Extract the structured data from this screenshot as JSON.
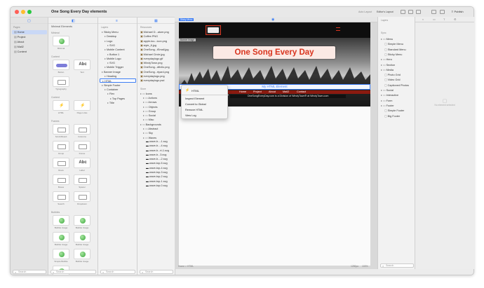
{
  "window": {
    "title": "One Song Every Day elements",
    "traffic_colors": [
      "#ff5f57",
      "#febc2e",
      "#28c840"
    ],
    "toolbar_info": "Auto Layout",
    "toolbar_layout": "Editor's Layout",
    "publish_label": "Publish"
  },
  "pages_panel": {
    "header": "Pages",
    "items": [
      {
        "label": "Home",
        "selected": true
      },
      {
        "label": "Project"
      },
      {
        "label": "About"
      },
      {
        "label": "Mail2"
      },
      {
        "label": "Content"
      }
    ],
    "search_placeholder": "Search"
  },
  "library_panel": {
    "header": "Minimal Elements",
    "sections": [
      {
        "title": "Minimal",
        "items": [
          "Minimal"
        ]
      },
      {
        "title": "Content",
        "items": [
          "Button",
          "Text",
          "Typography"
        ]
      },
      {
        "title": "Content",
        "items": [
          "HTML",
          "Page Links"
        ]
      },
      {
        "title": "Frames",
        "items": [
          "Scroll-Board",
          "Columns",
          "Group",
          "Frame",
          "Rows",
          "Label",
          "Boxes",
          "Spacer",
          "Search",
          "Dropdown"
        ]
      },
      {
        "title": "Bubbles",
        "items": [
          "Bubble Image",
          "Bubble Image",
          "Bubble Image",
          "Bubble Image",
          "Simple Bubble",
          "Bubble Image",
          "Library Menu"
        ]
      },
      {
        "title": "Interactive",
        "items": []
      }
    ],
    "search_placeholder": "Search"
  },
  "layers_panel": {
    "header": "Layers",
    "items": [
      {
        "label": "Sticky Menu",
        "indent": 0
      },
      {
        "label": "Desktop",
        "indent": 1
      },
      {
        "label": "Logo",
        "indent": 1
      },
      {
        "label": "SVG",
        "indent": 2
      },
      {
        "label": "Mobile Content",
        "indent": 1
      },
      {
        "label": "Button 1",
        "indent": 2
      },
      {
        "label": "Mobile Logo",
        "indent": 1
      },
      {
        "label": "SVG",
        "indent": 2
      },
      {
        "label": "Mobile Trigger",
        "indent": 1
      },
      {
        "label": "Banner Image",
        "indent": 0
      },
      {
        "label": "Heading",
        "indent": 1
      },
      {
        "label": "HTML",
        "indent": 0,
        "selected": true
      },
      {
        "label": "Simple Footer",
        "indent": 0
      },
      {
        "label": "Container",
        "indent": 1
      },
      {
        "label": "Flex",
        "indent": 2
      },
      {
        "label": "Top Pages",
        "indent": 3
      },
      {
        "label": "Title",
        "indent": 2
      }
    ],
    "search_placeholder": "Search"
  },
  "resources_panel": {
    "header": "Resources",
    "files": [
      "Michael D...ature.png",
      "Coffee.PNG",
      "apple-tou...icon.png",
      "style_8.jpg",
      "OneSong...tSmall.jpg",
      "Michael Circle.jpg",
      "everydaylogo.gif",
      "WindyTown.png",
      "OneSong...dth4lo.png",
      "OneSong...rtyard.png",
      "everydaylogo.png",
      "everydaylogo.psd"
    ],
    "folders_header": "Store",
    "folders": [
      {
        "label": "Icons",
        "indent": 0
      },
      {
        "label": "Actions",
        "indent": 1
      },
      {
        "label": "Arrows",
        "indent": 1
      },
      {
        "label": "Objects",
        "indent": 1
      },
      {
        "label": "Group",
        "indent": 1
      },
      {
        "label": "Social",
        "indent": 1
      },
      {
        "label": "Misc",
        "indent": 1
      },
      {
        "label": "Backgrounds",
        "indent": 0
      },
      {
        "label": "Abstract",
        "indent": 1
      },
      {
        "label": "Sky",
        "indent": 1
      },
      {
        "label": "Waves",
        "indent": 1
      }
    ],
    "waves": [
      "wave-b...-1.svg",
      "wave-b...-4.svg",
      "wave-b...rt-1.svg",
      "wave-b...3.svg",
      "wave-b...-2.svg",
      "wave-top-5.svg",
      "wave-top-4.svg",
      "wave-top-3.svg",
      "wave-top-2.svg",
      "wave-top-1.svg",
      "wave-top-0.svg"
    ],
    "search_placeholder": "Search"
  },
  "canvas": {
    "breadcrumb": "Home > HTML",
    "zoom": "100%",
    "size": "1280px",
    "page_tag": "Sticky Menu",
    "banner_tag": "Banner Image",
    "hero_title": "One Song Every Day",
    "html_element_label": "My HTML Element",
    "nav_items": [
      "Home",
      "Project",
      "About",
      "Mail2",
      "Contact"
    ],
    "footer_text": "OneSongEveryDay.com is a Division of WindyTown® at WindyTown.com",
    "hero_colors": {
      "banner_bg": "#fbe9e4",
      "title": "#d9341e",
      "nav": "#8a1a10"
    }
  },
  "context_menu": {
    "header": "HTML",
    "items": [
      "Inspect Element",
      "Convert to Global",
      "Remove HTML",
      "View Log"
    ]
  },
  "inspector": {
    "header": "Layers",
    "subheader": "Sync",
    "tree": [
      {
        "label": "Menu",
        "indent": 0
      },
      {
        "label": "Simple Menu",
        "indent": 1
      },
      {
        "label": "Standard Menu",
        "indent": 1
      },
      {
        "label": "Sticky Menu",
        "indent": 1
      },
      {
        "label": "Hero",
        "indent": 0
      },
      {
        "label": "Section",
        "indent": 0
      },
      {
        "label": "Media",
        "indent": 0
      },
      {
        "label": "Photo Grid",
        "indent": 1
      },
      {
        "label": "Video Grid",
        "indent": 1
      },
      {
        "label": "Captioned Photos",
        "indent": 1
      },
      {
        "label": "Social",
        "indent": 0
      },
      {
        "label": "Interactive",
        "indent": 0
      },
      {
        "label": "Form",
        "indent": 0
      },
      {
        "label": "Footer",
        "indent": 0
      },
      {
        "label": "Simple Footer",
        "indent": 1
      },
      {
        "label": "Big Footer",
        "indent": 1
      }
    ],
    "empty_note": "No element selected",
    "search_placeholder": "Search"
  }
}
